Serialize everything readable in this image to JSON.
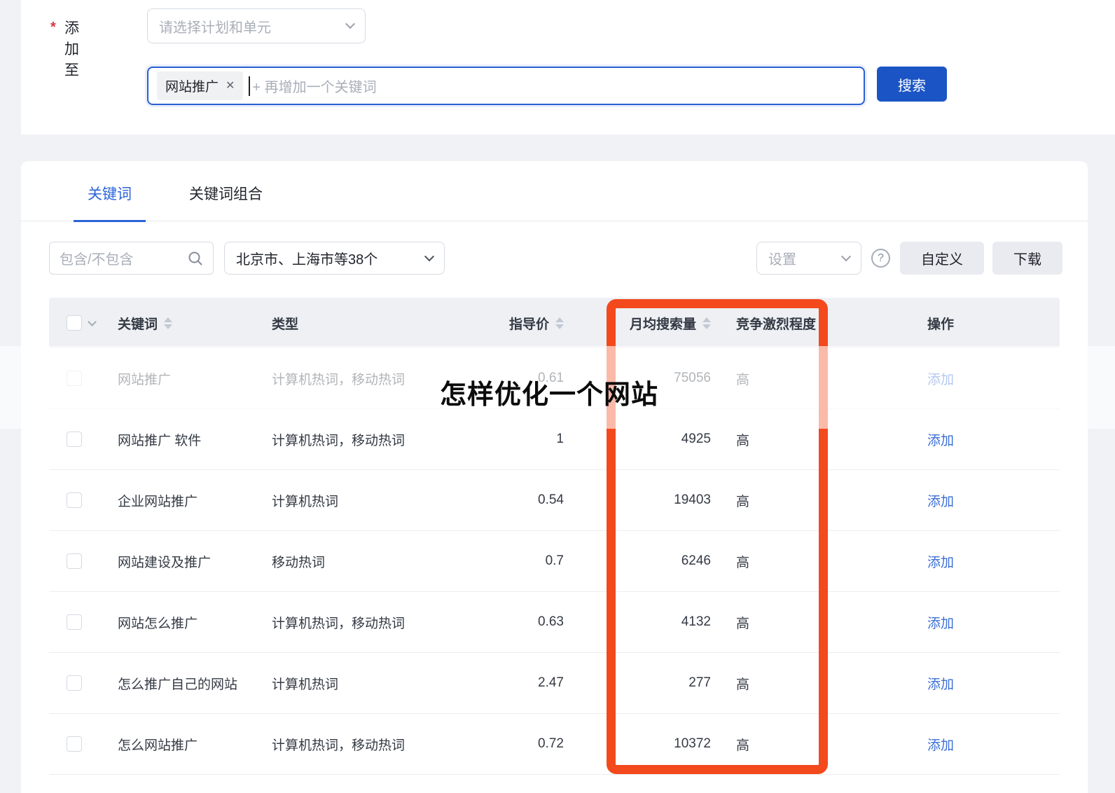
{
  "form": {
    "required_mark": "*",
    "add_to_label": "添加至",
    "plan_select_placeholder": "请选择计划和单元",
    "keyword_tag": "网站推广",
    "keyword_input_placeholder": "+ 再增加一个关键词",
    "search_button": "搜索"
  },
  "tabs": [
    {
      "label": "关键词",
      "active": true
    },
    {
      "label": "关键词组合",
      "active": false
    }
  ],
  "toolbar": {
    "filter_placeholder": "包含/不包含",
    "region_select_value": "北京市、上海市等38个",
    "settings_select_label": "设置",
    "help_icon": "?",
    "customize_button": "自定义",
    "download_button": "下载"
  },
  "table": {
    "columns": [
      "关键词",
      "类型",
      "指导价",
      "月均搜索量",
      "竞争激烈程度",
      "操作"
    ],
    "rows": [
      {
        "keyword": "网站推广",
        "type": "计算机热词，移动热词",
        "bid": "0.61",
        "volume": "75056",
        "competition": "高",
        "action": "添加"
      },
      {
        "keyword": "网站推广 软件",
        "type": "计算机热词，移动热词",
        "bid": "1",
        "volume": "4925",
        "competition": "高",
        "action": "添加"
      },
      {
        "keyword": "企业网站推广",
        "type": "计算机热词",
        "bid": "0.54",
        "volume": "19403",
        "competition": "高",
        "action": "添加"
      },
      {
        "keyword": "网站建设及推广",
        "type": "移动热词",
        "bid": "0.7",
        "volume": "6246",
        "competition": "高",
        "action": "添加"
      },
      {
        "keyword": "网站怎么推广",
        "type": "计算机热词，移动热词",
        "bid": "0.63",
        "volume": "4132",
        "competition": "高",
        "action": "添加"
      },
      {
        "keyword": "怎么推广自己的网站",
        "type": "计算机热词",
        "bid": "2.47",
        "volume": "277",
        "competition": "高",
        "action": "添加"
      },
      {
        "keyword": "怎么网站推广",
        "type": "计算机热词，移动热词",
        "bid": "0.72",
        "volume": "10372",
        "competition": "高",
        "action": "添加"
      }
    ]
  },
  "overlay": {
    "watermark_text": "怎样优化一个网站",
    "highlight_color": "#f3491c"
  },
  "colors": {
    "primary_blue": "#1b55c5",
    "link_blue": "#3b6fd6",
    "tab_active_blue": "#2b64d9",
    "asterisk_red": "#d9363e",
    "page_background": "#f0f2f5",
    "table_header_background": "#eef0f4"
  }
}
